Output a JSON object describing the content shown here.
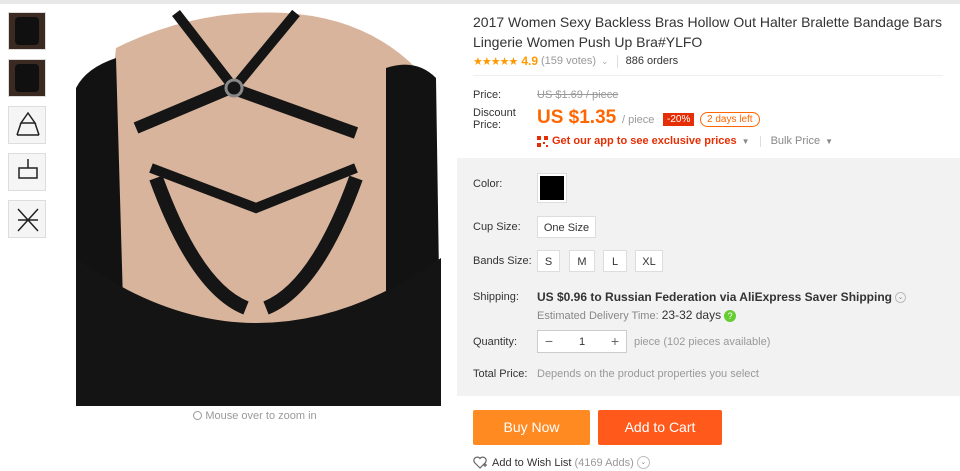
{
  "product": {
    "title": "2017 Women Sexy Backless Bras Hollow Out Halter Bralette Bandage Bars Lingerie Women Push Up Bra#YLFO",
    "rating": "4.9",
    "votes": "(159 votes)",
    "orders": "886 orders"
  },
  "thumbnails": [
    "thumb-1",
    "thumb-2",
    "thumb-3",
    "thumb-4",
    "thumb-5"
  ],
  "zoom_hint": "Mouse over to zoom in",
  "price": {
    "label": "Price:",
    "original": "US $1.69 / piece",
    "discount_label": "Discount Price:",
    "current": "US $1.35",
    "per": "/ piece",
    "discount_badge": "-20%",
    "days_left": "2 days left",
    "app_link": "Get our app to see exclusive prices",
    "bulk": "Bulk Price"
  },
  "options": {
    "color_label": "Color:",
    "color_value": "#000000",
    "cup_label": "Cup Size:",
    "cup_options": [
      "One Size"
    ],
    "band_label": "Bands Size:",
    "band_options": [
      "S",
      "M",
      "L",
      "XL"
    ]
  },
  "shipping": {
    "label": "Shipping:",
    "value": "US $0.96 to Russian Federation via AliExpress Saver Shipping",
    "delivery_label": "Estimated Delivery Time:",
    "delivery_value": "23-32 days"
  },
  "quantity": {
    "label": "Quantity:",
    "minus": "−",
    "value": "1",
    "plus": "+",
    "available": "piece (102 pieces available)"
  },
  "total": {
    "label": "Total Price:",
    "value": "Depends on the product properties you select"
  },
  "actions": {
    "buy_now": "Buy Now",
    "add_to_cart": "Add to Cart",
    "wishlist": "Add to Wish List",
    "wishlist_count": "(4169 Adds)"
  },
  "colors": {
    "accent_orange": "#ff6600",
    "buy_button": "#ff8a22",
    "cart_button": "#ff5a1c",
    "badge_red": "#e62e04",
    "star": "#ff9900"
  }
}
